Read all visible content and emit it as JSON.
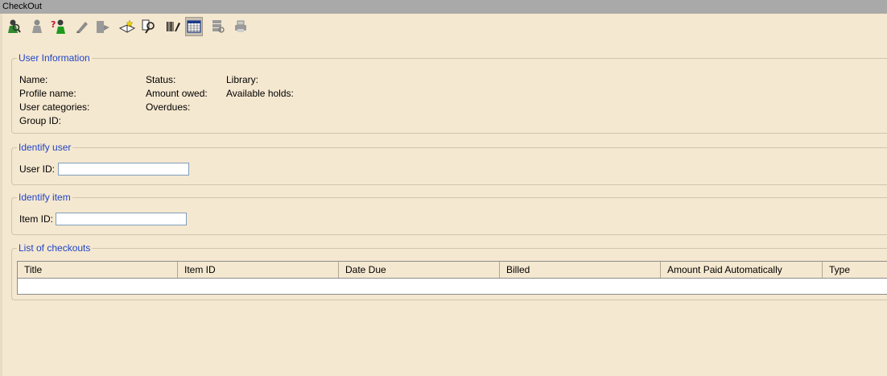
{
  "window": {
    "title": "CheckOut"
  },
  "toolbar": {
    "icons": [
      "user-search-icon",
      "user-icon",
      "user-help-icon",
      "pen-icon",
      "user-arrow-icon",
      "book-add-icon",
      "search-magnifier-icon",
      "barcode-icon",
      "calendar-grid-icon",
      "stack-icon",
      "printer-icon"
    ],
    "active_index": 8
  },
  "user_info": {
    "legend": "User Information",
    "name_label": "Name:",
    "profile_label": "Profile name:",
    "categories_label": "User categories:",
    "group_label": "Group ID:",
    "status_label": "Status:",
    "amount_owed_label": "Amount owed:",
    "overdues_label": "Overdues:",
    "library_label": "Library:",
    "holds_label": "Available holds:"
  },
  "identify_user": {
    "legend": "Identify user",
    "label": "User ID:",
    "value": ""
  },
  "identify_item": {
    "legend": "Identify item",
    "label": "Item ID:",
    "value": ""
  },
  "checkouts": {
    "legend": "List of checkouts",
    "columns": [
      "Title",
      "Item ID",
      "Date Due",
      "Billed",
      "Amount Paid Automatically",
      "Type"
    ]
  }
}
